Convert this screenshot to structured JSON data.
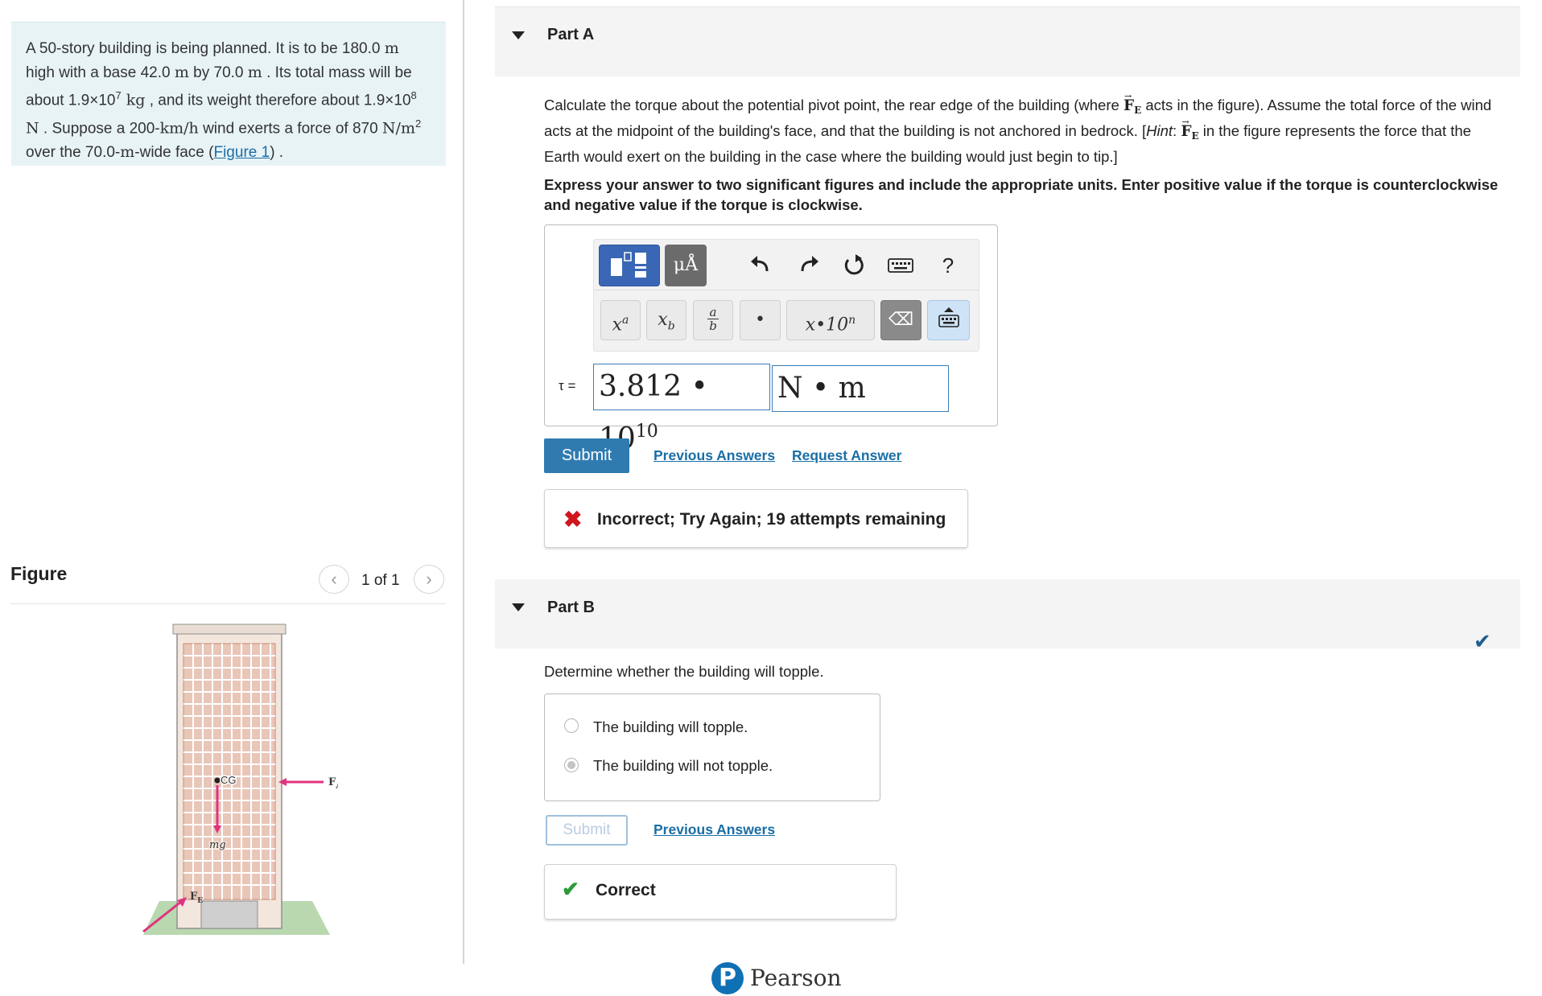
{
  "problem": {
    "text_1": "A 50-story building is being planned. It is to be 180.0 ",
    "unit_m1": "m",
    "text_2": " high with a base 42.0 ",
    "unit_m2": "m",
    "text_3": " by 70.0 ",
    "unit_m3": "m",
    "text_4": " . Its total mass will be about 1.9×10",
    "exp_mass": "7",
    "unit_kg": " kg",
    "text_5": " , and its weight therefore about 1.9×10",
    "exp_weight": "8",
    "unit_N": " N",
    "text_6": " . Suppose a 200-",
    "unit_kmh": "km/h",
    "text_7": " wind exerts a force of 870 ",
    "unit_nm2": "N/m",
    "exp_area": "2",
    "text_8": " over the 70.0-",
    "unit_m4": "m",
    "text_9": "-wide face (",
    "figure_link": "Figure 1",
    "text_10": ") ."
  },
  "figure": {
    "heading": "Figure",
    "counter": "1 of 1",
    "prev_icon": "chevron-left-icon",
    "next_icon": "chevron-right-icon",
    "label_cg": "CG",
    "label_fa": "F",
    "label_fa_sub": "A",
    "label_mg": "mg",
    "label_fe": "F",
    "label_fe_sub": "E",
    "colors": {
      "arrow": "#e0337f",
      "ground": "#b9d8b0",
      "building": "#d9a08a"
    }
  },
  "partA": {
    "title": "Part A",
    "q_1": "Calculate the torque about the potential pivot point, the rear edge of the building (where ",
    "vec": "F",
    "vec_sub": "E",
    "q_2": " acts in the figure). Assume the total force of the wind acts at the midpoint of the building's face, and that the building is not anchored in bedrock. [",
    "hint": "Hint",
    "q_3": ": ",
    "q_4": " in the figure represents the force that the Earth would exert on the building in the case where the building would just begin to tip.]",
    "instructions": "Express your answer to two significant figures and include the appropriate units. Enter positive value if the torque is counterclockwise and negative value if the torque is clockwise.",
    "toolbar": {
      "units_label": "μÅ",
      "undo_icon": "undo-icon",
      "redo_icon": "redo-icon",
      "reset_icon": "reset-icon",
      "keyboard_icon": "keyboard-icon",
      "help_label": "?",
      "key_sup_base": "x",
      "key_sup_exp": "a",
      "key_sub_base": "x",
      "key_sub_sub": "b",
      "key_frac_num": "a",
      "key_frac_den": "b",
      "key_dot": "•",
      "key_sci": "x•10",
      "key_sci_exp": "n",
      "key_back": "⌫"
    },
    "answer_label": "τ =",
    "answer_value": "3.812 • 10",
    "answer_exp": "10",
    "answer_unit": "N • m",
    "submit": "Submit",
    "previous_answers": "Previous Answers",
    "request_answer": "Request Answer",
    "feedback_icon": "✖",
    "feedback": "Incorrect; Try Again; 19 attempts remaining"
  },
  "partB": {
    "title": "Part B",
    "status_icon": "✔",
    "question": "Determine whether the building will topple.",
    "choices": [
      "The building will topple.",
      "The building will not topple."
    ],
    "selected_index": 1,
    "submit": "Submit",
    "previous_answers": "Previous Answers",
    "feedback_icon": "✔",
    "feedback": "Correct"
  },
  "footer": {
    "logo_letter": "P",
    "brand": "Pearson"
  }
}
